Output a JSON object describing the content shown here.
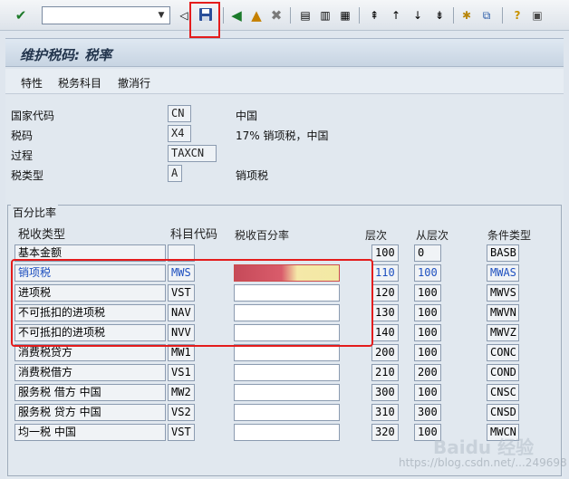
{
  "toolbar": {
    "command_value": "",
    "buttons": [
      "ok-icon",
      "back-arrow-icon",
      "save-icon",
      "back-icon",
      "exit-icon",
      "cancel-icon",
      "print-icon",
      "find-icon",
      "find-next-icon",
      "first-page-icon",
      "prev-page-icon",
      "next-page-icon",
      "last-page-icon",
      "new-session-icon",
      "shortcut-icon",
      "help-icon",
      "layout-icon"
    ]
  },
  "title": "维护税码: 税率",
  "app_menu": [
    "特性",
    "税务科目",
    "撤消行"
  ],
  "header": {
    "country_label": "国家代码",
    "country_code": "CN",
    "country_name": "中国",
    "taxcode_label": "税码",
    "taxcode": "X4",
    "taxcode_desc": "17% 销项税，中国",
    "procedure_label": "过程",
    "procedure": "TAXCN",
    "taxtype_label": "税类型",
    "taxtype": "A",
    "taxtype_desc": "销项税"
  },
  "group_title": "百分比率",
  "columns": {
    "tax_type": "税收类型",
    "account_key": "科目代码",
    "rate": "税收百分率",
    "level": "层次",
    "from_level": "从层次",
    "cond_type": "条件类型"
  },
  "rows": [
    {
      "name": "基本金额",
      "key": "",
      "rate": "",
      "level": "100",
      "from": "0",
      "cond": "BASB"
    },
    {
      "name": "销项税",
      "key": "MWS",
      "rate": "",
      "level": "110",
      "from": "100",
      "cond": "MWAS"
    },
    {
      "name": "进项税",
      "key": "VST",
      "rate": "",
      "level": "120",
      "from": "100",
      "cond": "MWVS"
    },
    {
      "name": "不可抵扣的进项税",
      "key": "NAV",
      "rate": "",
      "level": "130",
      "from": "100",
      "cond": "MWVN"
    },
    {
      "name": "不可抵扣的进项税",
      "key": "NVV",
      "rate": "",
      "level": "140",
      "from": "100",
      "cond": "MWVZ"
    },
    {
      "name": "消费税贷方",
      "key": "MW1",
      "rate": "",
      "level": "200",
      "from": "100",
      "cond": "CONC"
    },
    {
      "name": "消费税借方",
      "key": "VS1",
      "rate": "",
      "level": "210",
      "from": "200",
      "cond": "COND"
    },
    {
      "name": "服务税 借方 中国",
      "key": "MW2",
      "rate": "",
      "level": "300",
      "from": "100",
      "cond": "CNSC"
    },
    {
      "name": "服务税 贷方 中国",
      "key": "VS2",
      "rate": "",
      "level": "310",
      "from": "300",
      "cond": "CNSD"
    },
    {
      "name": "均一税 中国",
      "key": "VST",
      "rate": "",
      "level": "320",
      "from": "100",
      "cond": "MWCN"
    }
  ],
  "watermark": {
    "brand": "Baidu 经验",
    "url": "https://blog.csdn.net/...249698"
  }
}
